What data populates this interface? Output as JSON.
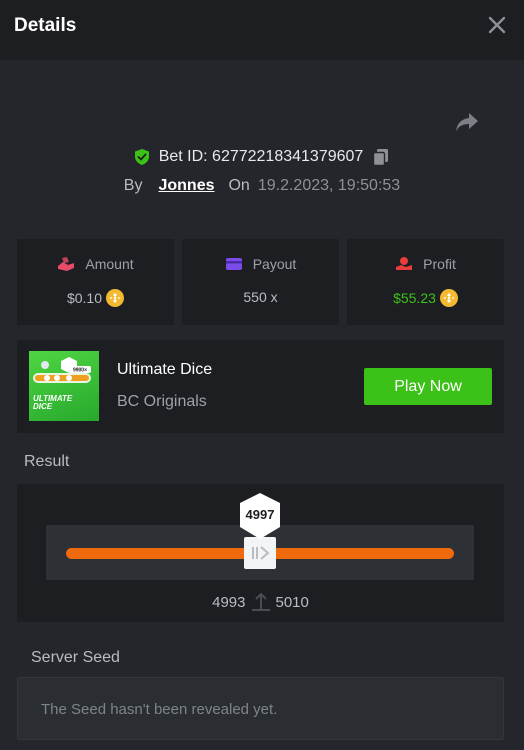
{
  "header": {
    "title": "Details",
    "close_icon": "close-icon"
  },
  "bet": {
    "id_label": "Bet ID: 62772218341379607",
    "by_label": "By",
    "user": "Jonnes",
    "on_label": "On",
    "date": "19.2.2023, 19:50:53"
  },
  "stats": [
    {
      "label": "Amount",
      "value": "$0.10",
      "icon": "amount-icon",
      "color": "#e84b6a",
      "coin": true
    },
    {
      "label": "Payout",
      "value": "550 x",
      "icon": "payout-icon",
      "color": "#7b4ce8",
      "coin": false
    },
    {
      "label": "Profit",
      "value": "$55.23",
      "icon": "profit-icon",
      "color": "#e83d3d",
      "coin": true,
      "value_color": "#3bc117"
    }
  ],
  "game": {
    "name": "Ultimate Dice",
    "provider": "BC Originals",
    "play_label": "Play Now",
    "thumb_title_1": "ULTIMATE",
    "thumb_title_2": "DICE",
    "thumb_multiplier": "9900×"
  },
  "result": {
    "label": "Result",
    "value": "4997",
    "range_low": "4993",
    "range_high": "5010"
  },
  "seed": {
    "label": "Server Seed",
    "message": "The Seed hasn't been revealed yet."
  },
  "colors": {
    "background": "#24262b",
    "panel": "#1c1e22",
    "accent_green": "#3bc117",
    "bar_orange": "#ee6a0c"
  }
}
